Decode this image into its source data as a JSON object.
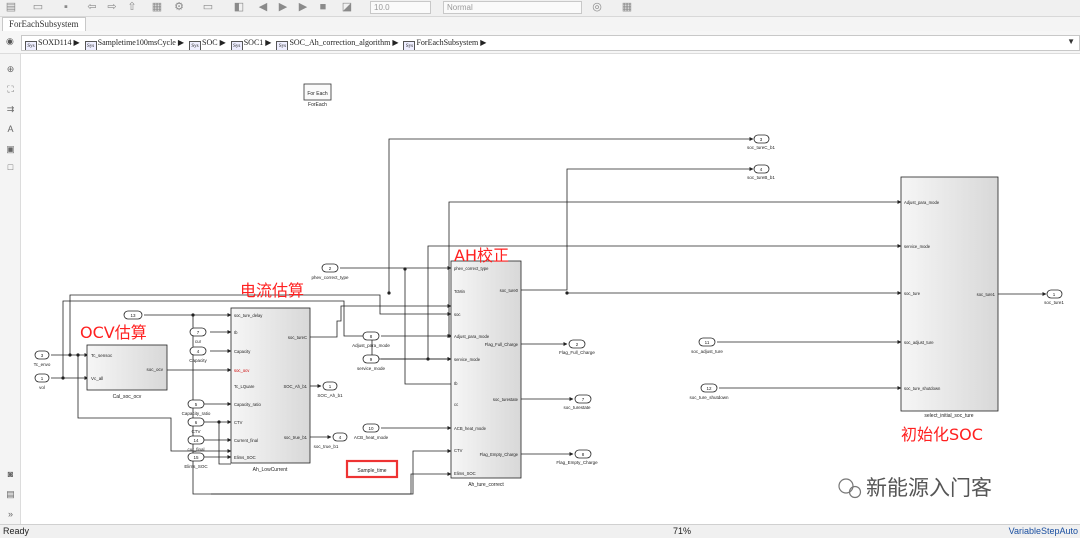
{
  "toolbar": {
    "step_size": "10.0",
    "sim_mode": "Normal"
  },
  "tab": {
    "label": "ForEachSubsystem"
  },
  "breadcrumb": [
    "SOXD114",
    "Sampletime100msCycle",
    "SOC",
    "SOC1",
    "SOC_Ah_correction_algorithm",
    "ForEachSubsystem"
  ],
  "diagram": {
    "foreach_block": {
      "title": "For Each",
      "caption": "ForEach"
    },
    "annotations": {
      "ocv": "OCV估算",
      "current": "电流估算",
      "ah": "AH校正",
      "init": "初始化SOC"
    },
    "inports": [
      {
        "num": "3",
        "label": "Tc_envo"
      },
      {
        "num": "1",
        "label": "vol"
      },
      {
        "num": "13",
        "label": ""
      },
      {
        "num": "7",
        "label": "cur"
      },
      {
        "num": "4",
        "label": "Capacity"
      },
      {
        "num": "5",
        "label": "Capacity_ratio"
      },
      {
        "num": "6",
        "label": "CTV"
      },
      {
        "num": "14",
        "label": "cur_final"
      },
      {
        "num": "15",
        "label": "Elims_SOC"
      },
      {
        "num": "2",
        "label": "phev_correct_type"
      },
      {
        "num": "8",
        "label": "Adjust_para_mode"
      },
      {
        "num": "9",
        "label": "service_mode"
      },
      {
        "num": "10",
        "label": "ACB_heat_mode"
      },
      {
        "num": "11",
        "label": "soc_adjust_ture"
      },
      {
        "num": "12",
        "label": "soc_ture_shutdown"
      }
    ],
    "outports": [
      {
        "num": "1",
        "label": "SOC_Ah_b1"
      },
      {
        "num": "4",
        "label": "soc_true_b1"
      },
      {
        "num": "2",
        "label": "Flag_Full_Charge"
      },
      {
        "num": "7",
        "label": "soc_turestate"
      },
      {
        "num": "8",
        "label": "Flag_Empty_Charge"
      },
      {
        "num": "3",
        "label": "soc_tureC_b1"
      },
      {
        "num": "4",
        "label": "soc_tureB_b1"
      },
      {
        "num": "1",
        "label": "soc_ture1"
      }
    ],
    "blocks": {
      "cal_soc_ocv": {
        "name": "Cal_soc_ocv",
        "in": [
          "Tc_sensoc",
          "Vc_all"
        ],
        "out": [
          "soc_ocv"
        ]
      },
      "ah_lowcurrent": {
        "name": "Ah_LowCurrent",
        "in": [
          "soc_ture_delay",
          "Ib",
          "Capacity",
          "soc_ocv",
          "Tc_LQuare",
          "Capacity_ratio",
          "CTV",
          "Current_final",
          "Elims_SOC"
        ],
        "out": [
          "soc_tureC",
          "SOC_Ah_b1",
          "soc_true_b1"
        ]
      },
      "ah_ture_correct": {
        "name": "Ah_ture_correct",
        "in": [
          "phev_correct_type",
          "TcMin",
          "soc",
          "Adjust_para_mode",
          "service_mode",
          "Ib",
          "cc",
          "ACB_heat_mode",
          "CTV",
          "Elims_SOC"
        ],
        "out": [
          "soc_ture0",
          "Flag_Full_Charge",
          "soc_turestate",
          "Flag_Empty_Charge"
        ]
      },
      "select_initial": {
        "name": "select_initial_soc_ture",
        "in": [
          "Adjust_para_mode",
          "service_mode",
          "soc_ture",
          "soc_adjust_ture",
          "soc_ture_shutdown"
        ],
        "out": [
          "soc_ture1"
        ]
      },
      "sample_time": {
        "name": "Sample_time"
      }
    },
    "watermark": "新能源入门客"
  },
  "status": {
    "left": "Ready",
    "zoom": "71%",
    "solver": "VariableStepAuto"
  }
}
